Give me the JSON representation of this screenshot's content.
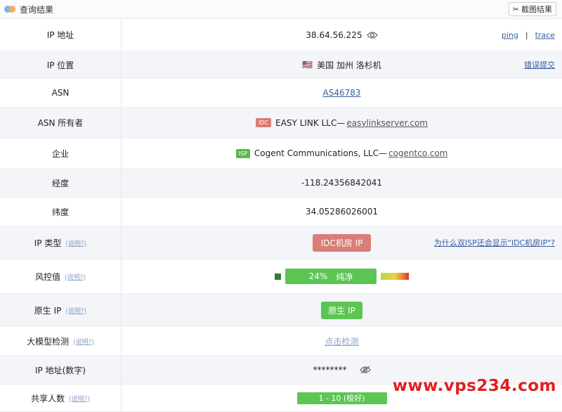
{
  "header": {
    "title": "查询结果",
    "screenshot_button": "截图结果"
  },
  "rows": {
    "ip": {
      "label": "IP 地址",
      "value": "38.64.56.225",
      "ping": "ping",
      "sep": "|",
      "trace": "trace"
    },
    "location": {
      "label": "IP 位置",
      "flag": "🇺🇸",
      "value": "美国 加州 洛杉机",
      "action": "错误提交"
    },
    "asn": {
      "label": "ASN",
      "value": "AS46783"
    },
    "asn_owner": {
      "label": "ASN 所有者",
      "tag": "IDC",
      "name": "EASY LINK LLC—",
      "domain": "easylinkserver.com"
    },
    "company": {
      "label": "企业",
      "tag": "ISP",
      "name": "Cogent Communications, LLC—",
      "domain": "cogentco.com"
    },
    "longitude": {
      "label": "经度",
      "value": "-118.24356842041"
    },
    "latitude": {
      "label": "纬度",
      "value": "34.05286026001"
    },
    "ip_type": {
      "label": "IP 类型",
      "hint": "(说明?)",
      "value": "IDC机房 IP",
      "right": "为什么双ISP还会显示\"IDC机房IP\"?"
    },
    "risk": {
      "label": "风控值",
      "hint": "(说明?)",
      "percent": "24%",
      "status": "纯净",
      "level": 0.24
    },
    "native": {
      "label": "原生 IP",
      "hint": "(说明?)",
      "value": "原生 IP"
    },
    "llm": {
      "label": "大模型检测",
      "hint": "(说明?)",
      "value": "点击检测"
    },
    "ip_numeric": {
      "label": "IP 地址(数字)",
      "value": "********"
    },
    "shared": {
      "label": "共享人数",
      "hint": "(说明?)",
      "value": "1 - 10 (极好)"
    }
  },
  "watermark": "www.vps234.com",
  "colors": {
    "green": "#5cc553",
    "red_pill": "#d97e76",
    "link": "#3a5ea0",
    "watermark": "#e02020"
  }
}
